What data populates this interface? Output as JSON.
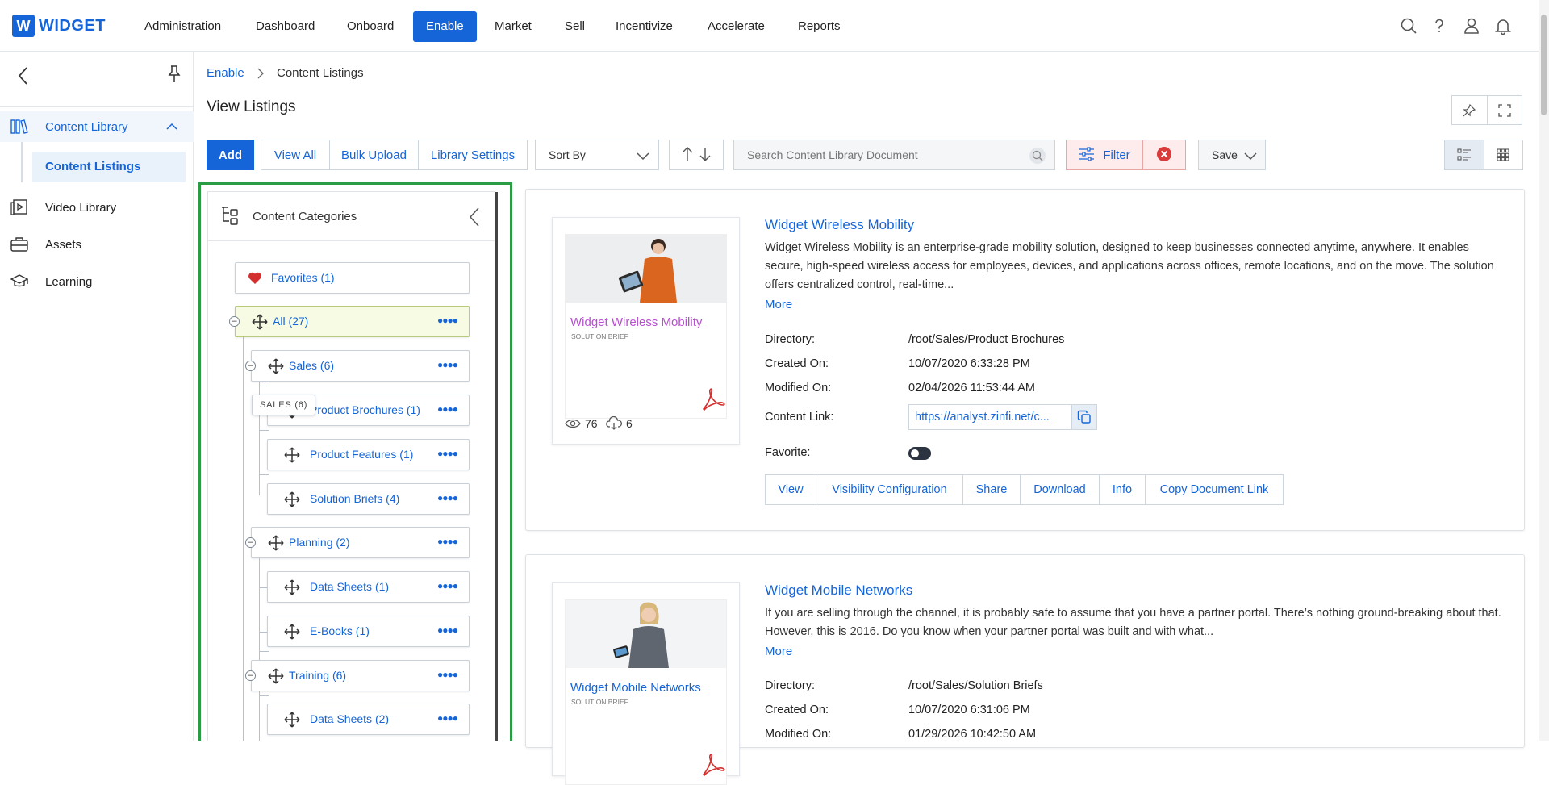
{
  "app": {
    "logo_letter": "W",
    "logo_name": "WIDGET",
    "brand_color": "#1565d8"
  },
  "nav": [
    {
      "label": "Administration"
    },
    {
      "label": "Dashboard"
    },
    {
      "label": "Onboard"
    },
    {
      "label": "Enable",
      "active": true
    },
    {
      "label": "Market"
    },
    {
      "label": "Sell"
    },
    {
      "label": "Incentivize"
    },
    {
      "label": "Accelerate"
    },
    {
      "label": "Reports"
    }
  ],
  "sidebar": {
    "items": [
      {
        "label": "Content Library",
        "expanded": true
      },
      {
        "label": "Content Listings",
        "selected": true
      },
      {
        "label": "Video Library"
      },
      {
        "label": "Assets"
      },
      {
        "label": "Learning"
      }
    ]
  },
  "breadcrumb": {
    "root": "Enable",
    "current": "Content Listings"
  },
  "page": {
    "title": "View Listings"
  },
  "toolbar": {
    "add": "Add",
    "view_all": "View All",
    "bulk_upload": "Bulk Upload",
    "library_settings": "Library Settings",
    "sort_by": "Sort By",
    "search_placeholder": "Search Content Library Document",
    "filter": "Filter",
    "save": "Save"
  },
  "categories": {
    "title": "Content Categories",
    "tooltip": "SALES (6)",
    "favorites": "Favorites (1)",
    "all": "All (27)",
    "sales": "Sales (6)",
    "product_brochures": "Product Brochures (1)",
    "product_features": "Product Features (1)",
    "solution_briefs": "Solution Briefs (4)",
    "planning": "Planning (2)",
    "data_sheets_1": "Data Sheets (1)",
    "ebooks": "E-Books (1)",
    "training": "Training (6)",
    "data_sheets_2": "Data Sheets (2)"
  },
  "listings": [
    {
      "title": "Widget Wireless Mobility",
      "thumb_title": "Widget Wireless Mobility",
      "thumb_subtitle": "SOLUTION BRIEF",
      "views": "76",
      "downloads": "6",
      "description": "Widget Wireless Mobility is an enterprise-grade mobility solution, designed to keep businesses connected anytime, anywhere. It enables secure, high-speed wireless access for employees, devices, and applications across offices, remote locations, and on the move. The solution offers centralized control, real-time...",
      "more": "More",
      "directory_label": "Directory:",
      "directory": "/root/Sales/Product Brochures",
      "created_label": "Created On:",
      "created": "10/07/2020 6:33:28 PM",
      "modified_label": "Modified On:",
      "modified": "02/04/2026 11:53:44 AM",
      "link_label": "Content Link:",
      "link": "https://analyst.zinfi.net/c...",
      "favorite_label": "Favorite:",
      "actions": [
        "View",
        "Visibility Configuration",
        "Share",
        "Download",
        "Info",
        "Copy Document Link"
      ]
    },
    {
      "title": "Widget Mobile Networks",
      "thumb_title": "Widget Mobile Networks",
      "thumb_subtitle": "SOLUTION BRIEF",
      "description": "If you are selling through the channel, it is probably safe to assume that you have a partner portal. There’s nothing ground-breaking about that. However, this is 2016. Do you know when your partner portal was built and with what...",
      "more": "More",
      "directory_label": "Directory:",
      "directory": "/root/Sales/Solution Briefs",
      "created_label": "Created On:",
      "created": "10/07/2020 6:31:06 PM",
      "modified_label": "Modified On:",
      "modified": "01/29/2026 10:42:50 AM"
    }
  ]
}
